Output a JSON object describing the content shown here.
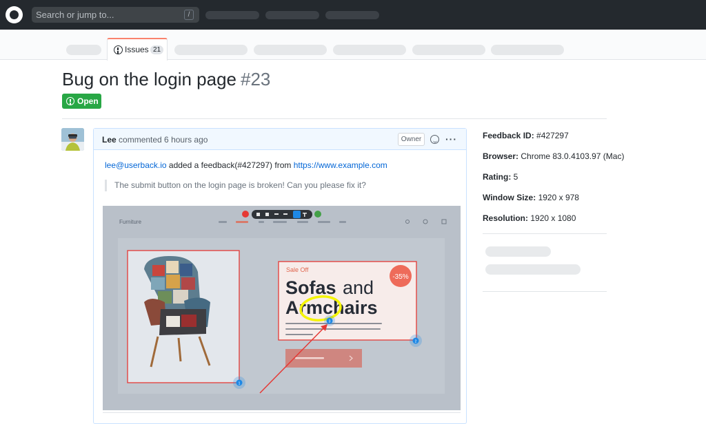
{
  "header": {
    "search_placeholder": "Search or jump to...",
    "search_shortcut": "/"
  },
  "repo_nav": {
    "issues_label": "Issues",
    "issues_count": "21"
  },
  "issue": {
    "title": "Bug on the login page",
    "number": "#23",
    "state": "Open"
  },
  "comment": {
    "author": "Lee",
    "meta": "commented 6 hours ago",
    "role_badge": "Owner",
    "email": "lee@userback.io",
    "action_text": "added a feedback(#427297) from",
    "url": "https://www.example.com",
    "quote": "The submit button on the login page is broken! Can you please fix it?"
  },
  "screenshot": {
    "brand": "Furniture",
    "sale_label": "Sale Off",
    "discount": "-35%",
    "heading_bold_1": "Sofas",
    "heading_light": "and",
    "heading_bold_2": "Armchairs",
    "marker_1": "1",
    "marker_2": "2",
    "marker_3": "3"
  },
  "sidebar": {
    "feedback_id_label": "Feedback ID:",
    "feedback_id_value": "#427297",
    "browser_label": "Browser:",
    "browser_value": "Chrome 83.0.4103.97 (Mac)",
    "rating_label": "Rating:",
    "rating_value": "5",
    "window_size_label": "Window Size:",
    "window_size_value": "1920 x 978",
    "resolution_label": "Resolution:",
    "resolution_value": "1920 x 1080"
  },
  "colors": {
    "header_bg": "#24292e",
    "open_green": "#28a745",
    "link_blue": "#0366d6",
    "annotation_red": "#e53935",
    "highlight_yellow": "#f5f500"
  }
}
